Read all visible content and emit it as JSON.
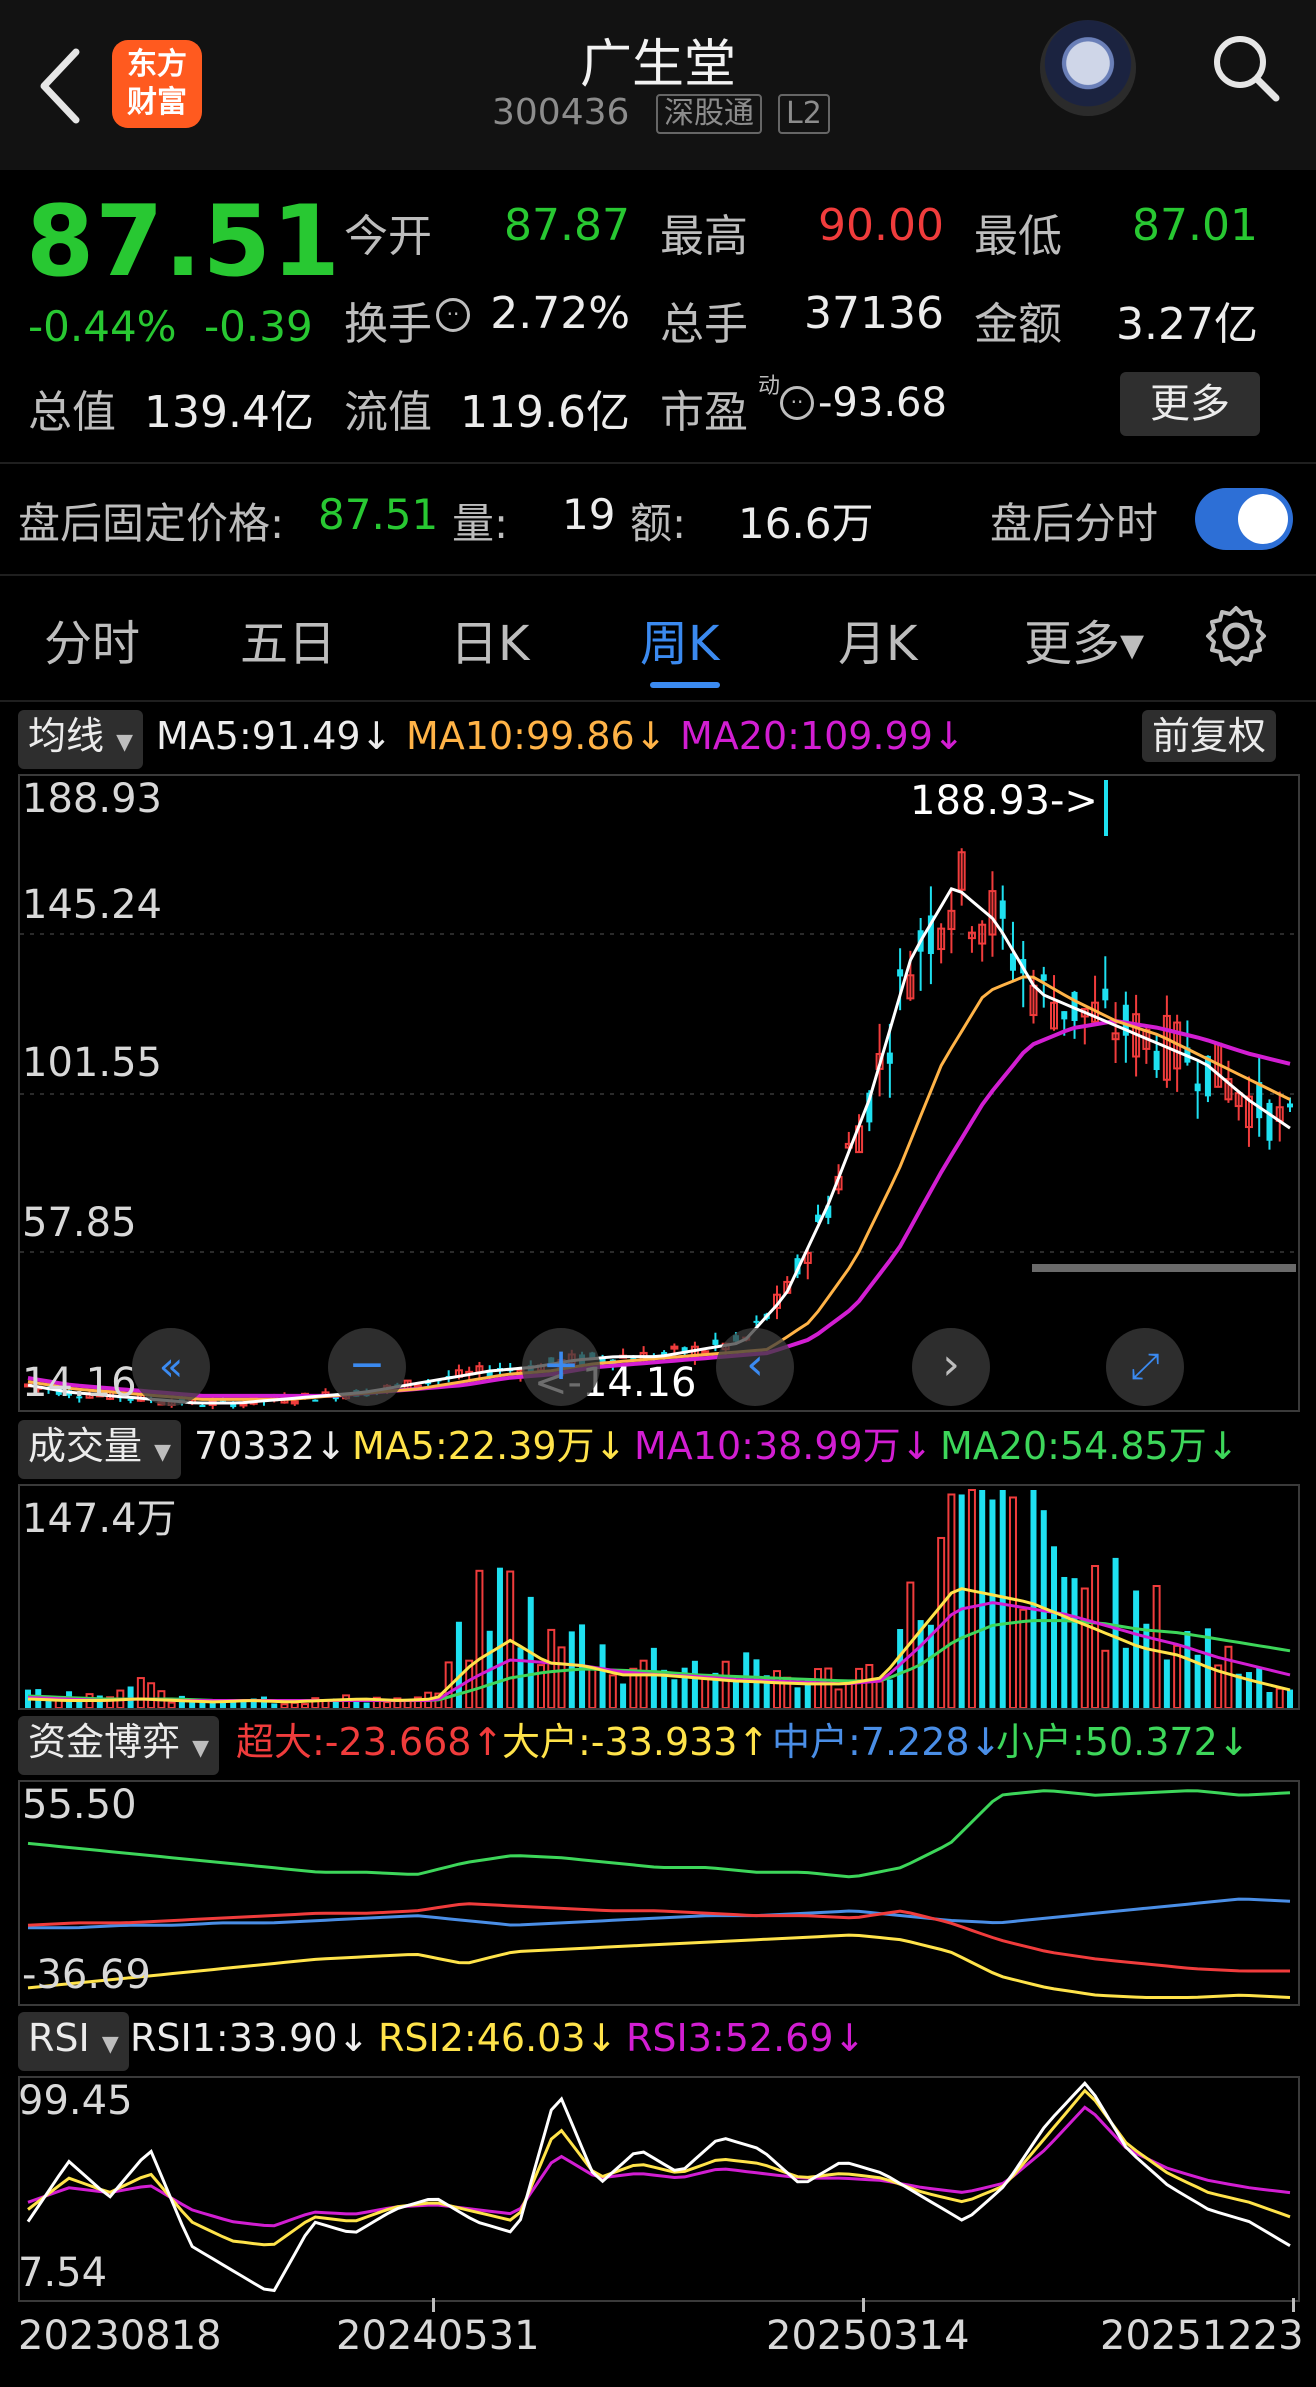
{
  "header": {
    "title": "广生堂",
    "code": "300436",
    "tags": [
      "深股通",
      "L2"
    ],
    "logo_text": [
      "东方",
      "财富"
    ]
  },
  "quote": {
    "price": "87.51",
    "change_pct": "-0.44%",
    "change_amt": "-0.39",
    "rows": [
      [
        {
          "label": "今开",
          "value": "87.87",
          "color": "green"
        },
        {
          "label": "最高",
          "value": "90.00",
          "color": "red"
        },
        {
          "label": "最低",
          "value": "87.01",
          "color": "green"
        }
      ],
      [
        {
          "label": "换手",
          "value": "2.72%",
          "color": "white"
        },
        {
          "label": "总手",
          "value": "37136",
          "color": "white"
        },
        {
          "label": "金额",
          "value": "3.27亿",
          "color": "white"
        }
      ]
    ],
    "total_value_label": "总值",
    "total_value": "139.4亿",
    "float_value_label": "流值",
    "float_value": "119.6亿",
    "pe_label": "市盈",
    "pe_sup": "动",
    "pe_value": "-93.68",
    "more_label": "更多"
  },
  "after_hours": {
    "label": "盘后固定价格:",
    "price": "87.51",
    "vol_label": "量:",
    "vol": "19",
    "amt_label": "额:",
    "amt": "16.6万",
    "toggle_label": "盘后分时",
    "toggle_on": true
  },
  "tabs": [
    "分时",
    "五日",
    "日K",
    "周K",
    "月K",
    "更多▾"
  ],
  "active_tab": "周K",
  "ma_bar": {
    "selector": "均线",
    "ma5": "MA5:91.49↓",
    "ma10": "MA10:99.86↓",
    "ma20": "MA20:109.99↓",
    "adjust": "前复权"
  },
  "price_chart": {
    "axis_labels": [
      "188.93",
      "145.24",
      "101.55",
      "57.85",
      "14.16"
    ],
    "high_marker": "188.93->",
    "low_marker": "<-14.16"
  },
  "volume_bar": {
    "selector": "成交量",
    "vol": "70332↓",
    "ma5": "MA5:22.39万↓",
    "ma10": "MA10:38.99万↓",
    "ma20": "MA20:54.85万↓",
    "axis_top": "147.4万"
  },
  "fund_bar": {
    "selector": "资金博弈",
    "super": "超大:-23.668↑",
    "large": "大户:-33.933↑",
    "mid": "中户:7.228↓",
    "small": "小户:50.372↓",
    "axis_top": "55.50",
    "axis_bottom": "-36.69"
  },
  "rsi_bar": {
    "selector": "RSI",
    "rsi1": "RSI1:33.90↓",
    "rsi2": "RSI2:46.03↓",
    "rsi3": "RSI3:52.69↓",
    "axis_top": "99.45",
    "axis_bottom": "7.54"
  },
  "dates": [
    "20230818",
    "20240531",
    "20250314",
    "20251223"
  ],
  "colors": {
    "up": "#f03c3c",
    "down": "#1ee0f0",
    "ma5": "#ffffff",
    "ma10": "#ffb347",
    "ma20": "#d21ed2",
    "accent": "#3b8af0"
  },
  "chart_data": [
    {
      "type": "line",
      "title": "",
      "series": [
        {
          "name": "MA5",
          "values": [
            20,
            18,
            17,
            16,
            15,
            15,
            16,
            17,
            18,
            20,
            22,
            24,
            25,
            27,
            28,
            28,
            30,
            32,
            45,
            70,
            100,
            140,
            160,
            150,
            130,
            125,
            120,
            115,
            110,
            100,
            92
          ]
        },
        {
          "name": "MA10",
          "values": [
            21,
            19,
            18,
            17,
            16,
            16,
            16,
            17,
            18,
            19,
            21,
            23,
            24,
            26,
            27,
            28,
            29,
            30,
            38,
            55,
            80,
            110,
            130,
            135,
            128,
            122,
            118,
            112,
            106,
            100
          ]
        },
        {
          "name": "MA20",
          "values": [
            22,
            20,
            19,
            18,
            17,
            17,
            17,
            17,
            18,
            19,
            20,
            22,
            23,
            25,
            26,
            27,
            28,
            29,
            33,
            42,
            58,
            80,
            100,
            115,
            120,
            122,
            120,
            117,
            113,
            110
          ]
        }
      ],
      "ylim": [
        14.16,
        188.93
      ]
    },
    {
      "type": "bar",
      "title": "",
      "series": [
        {
          "name": "MA5",
          "values": []
        },
        {
          "name": "MA10",
          "values": []
        },
        {
          "name": "MA20",
          "values": []
        }
      ],
      "ylim": [
        0,
        147.4
      ]
    },
    {
      "type": "line",
      "title": "",
      "series": [
        {
          "name": "超大",
          "values": []
        },
        {
          "name": "大户",
          "values": []
        },
        {
          "name": "中户",
          "values": []
        },
        {
          "name": "小户",
          "values": []
        }
      ],
      "ylim": [
        -36.69,
        55.5
      ]
    },
    {
      "type": "line",
      "title": "",
      "series": [
        {
          "name": "RSI1",
          "values": []
        },
        {
          "name": "RSI2",
          "values": []
        },
        {
          "name": "RSI3",
          "values": []
        }
      ],
      "ylim": [
        7.54,
        99.45
      ]
    }
  ]
}
